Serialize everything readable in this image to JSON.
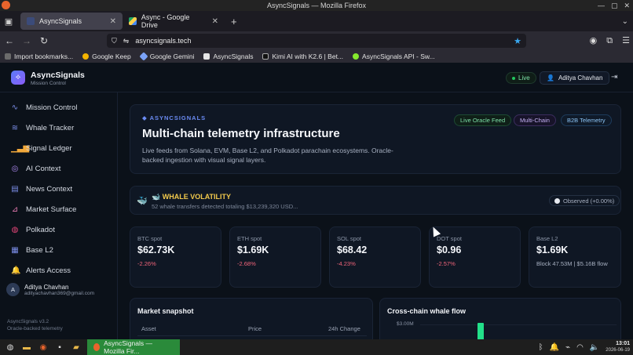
{
  "window": {
    "title": "AsyncSignals — Mozilla Firefox"
  },
  "tabs": [
    {
      "label": "AsyncSignals",
      "active": true
    },
    {
      "label": "Async - Google Drive",
      "active": false
    }
  ],
  "url": "asyncsignals.tech",
  "bookmarks": [
    {
      "label": "Import bookmarks...",
      "icon": "import-icon"
    },
    {
      "label": "Google Keep",
      "icon": "keep-icon"
    },
    {
      "label": "Google Gemini",
      "icon": "gemini-icon"
    },
    {
      "label": "AsyncSignals",
      "icon": "asyncsignals-icon"
    },
    {
      "label": "Kimi AI with K2.6 | Bet...",
      "icon": "kimi-icon"
    },
    {
      "label": "AsyncSignals API - Sw...",
      "icon": "api-icon"
    }
  ],
  "app": {
    "brand": "AsyncSignals",
    "subtitle": "Mission Control",
    "live": "Live",
    "user": "Aditya Chavhan"
  },
  "sidebar": {
    "items": [
      {
        "label": "Mission Control",
        "icon": "pulse-icon"
      },
      {
        "label": "Whale Tracker",
        "icon": "waves-icon"
      },
      {
        "label": "Signal Ledger",
        "icon": "bars-icon"
      },
      {
        "label": "AI Context",
        "icon": "ai-icon"
      },
      {
        "label": "News Context",
        "icon": "news-icon"
      },
      {
        "label": "Market Surface",
        "icon": "chart-icon"
      },
      {
        "label": "Polkadot",
        "icon": "polkadot-icon"
      },
      {
        "label": "Base L2",
        "icon": "layers-icon"
      },
      {
        "label": "Alerts Access",
        "icon": "bell-icon"
      }
    ],
    "user_initial": "A",
    "user_name": "Aditya Chavhan",
    "user_email": "adityachavhan369@gmail.com",
    "version": "AsyncSignals v3.2",
    "footnote": "Oracle-backed telemetry"
  },
  "hero": {
    "eyebrow": "◆ ASYNCSIGNALS",
    "title": "Multi-chain telemetry infrastructure",
    "desc": "Live feeds from Solana, EVM, Base L2, and Polkadot parachain ecosystems. Oracle-backed ingestion with visual signal layers.",
    "chips": [
      "Live Oracle Feed",
      "Multi-Chain",
      "B2B Telemetry"
    ]
  },
  "whale": {
    "title": "🐋 WHALE VOLATILITY",
    "summary": "52 whale transfers detected totaling $13,239,320 USD...",
    "observed": "Observed (+0.00%)"
  },
  "spots": [
    {
      "label": "BTC spot",
      "value": "$62.73K",
      "change": "-2.26%"
    },
    {
      "label": "ETH spot",
      "value": "$1.69K",
      "change": "-2.68%"
    },
    {
      "label": "SOL spot",
      "value": "$68.42",
      "change": "-4.23%"
    },
    {
      "label": "DOT spot",
      "value": "$0.96",
      "change": "-2.57%"
    },
    {
      "label": "Base L2",
      "value": "$1.69K",
      "change": "Block 47.53M | $5.16B flow"
    }
  ],
  "market": {
    "title": "Market snapshot",
    "cols": [
      "Asset",
      "Price",
      "24h Change"
    ]
  },
  "flow": {
    "title": "Cross-chain whale flow",
    "ytick": "$3.00M"
  },
  "taskbar": {
    "app": "AsyncSignals — Mozilla Fir...",
    "time": "13:01",
    "date": "2026-06-19"
  }
}
